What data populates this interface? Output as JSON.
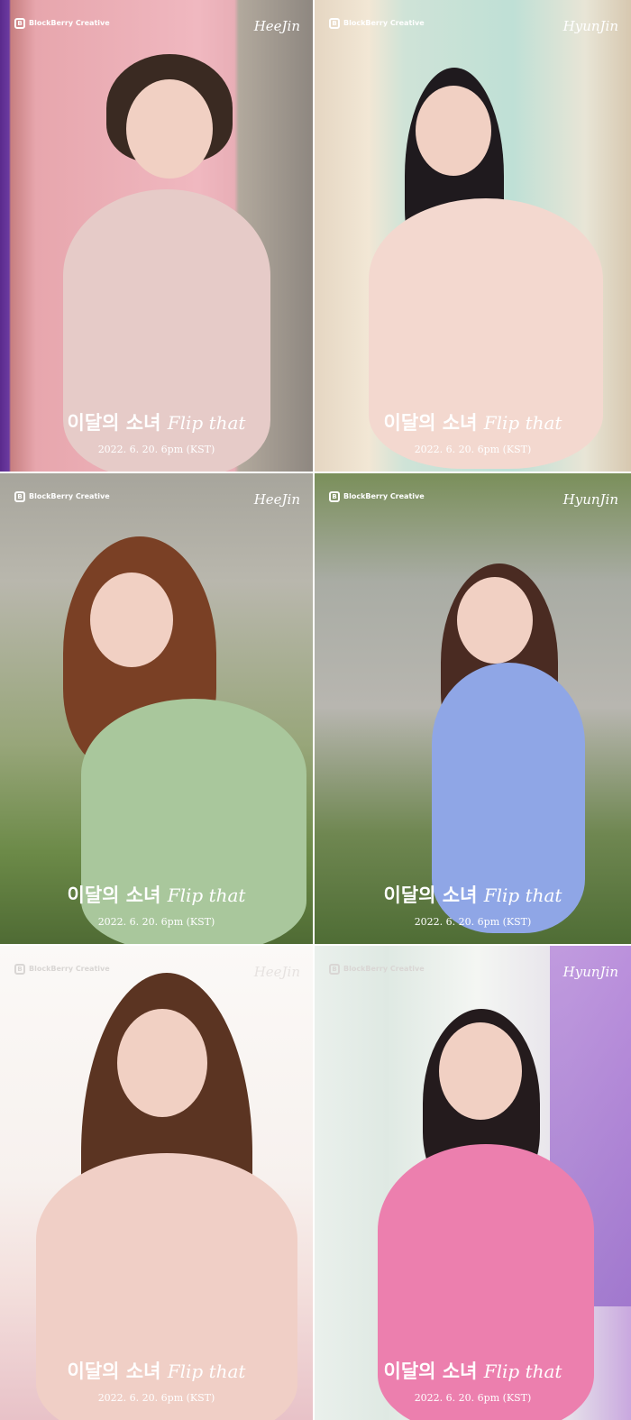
{
  "teasers": [
    {
      "logo": "BlockBerry Creative",
      "member": "HeeJin",
      "title_ko": "이달의 소녀",
      "title_sub": "Flip that",
      "date": "2022. 6. 20. 6pm (KST)"
    },
    {
      "logo": "BlockBerry Creative",
      "member": "HyunJin",
      "title_ko": "이달의 소녀",
      "title_sub": "Flip that",
      "date": "2022. 6. 20. 6pm (KST)"
    },
    {
      "logo": "BlockBerry Creative",
      "member": "HeeJin",
      "title_ko": "이달의 소녀",
      "title_sub": "Flip that",
      "date": "2022. 6. 20. 6pm (KST)"
    },
    {
      "logo": "BlockBerry Creative",
      "member": "HyunJin",
      "title_ko": "이달의 소녀",
      "title_sub": "Flip that",
      "date": "2022. 6. 20. 6pm (KST)"
    },
    {
      "logo": "BlockBerry Creative",
      "member": "HeeJin",
      "title_ko": "이달의 소녀",
      "title_sub": "Flip that",
      "date": "2022. 6. 20. 6pm (KST)"
    },
    {
      "logo": "BlockBerry Creative",
      "member": "HyunJin",
      "title_ko": "이달의 소녀",
      "title_sub": "Flip that",
      "date": "2022. 6. 20. 6pm (KST)"
    }
  ]
}
